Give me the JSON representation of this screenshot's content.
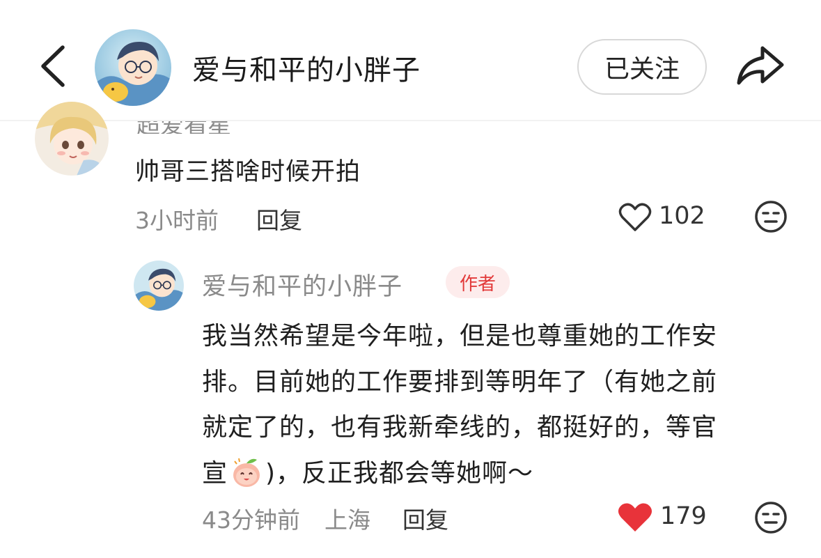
{
  "header": {
    "back_icon": "chevron-left-icon",
    "author_name": "爱与和平的小胖子",
    "follow_label": "已关注",
    "share_icon": "share-arrow-icon"
  },
  "comments": [
    {
      "name_partial": "超爱看星",
      "text": "帅哥三搭啥时候开拍",
      "time": "3小时前",
      "reply_label": "回复",
      "likes": "102",
      "liked": false
    }
  ],
  "reply": {
    "name": "爱与和平的小胖子",
    "badge": "作者",
    "lines": [
      "我当然希望是今年啦，但是也尊重她的工作安",
      "排。目前她的工作要排到等明年了（有她之前",
      "就定了的，也有我新牵线的，都挺好的，等官"
    ],
    "last_line_prefix": "宣",
    "last_line_suffix": ")，反正我都会等她啊～",
    "time": "43分钟前",
    "location": "上海",
    "reply_label": "回复",
    "likes": "179",
    "liked": true
  },
  "colors": {
    "liked_heart": "#e8333a",
    "badge_bg": "#fdecec",
    "badge_text": "#e23a3a",
    "muted_text": "#8a8a8a"
  }
}
